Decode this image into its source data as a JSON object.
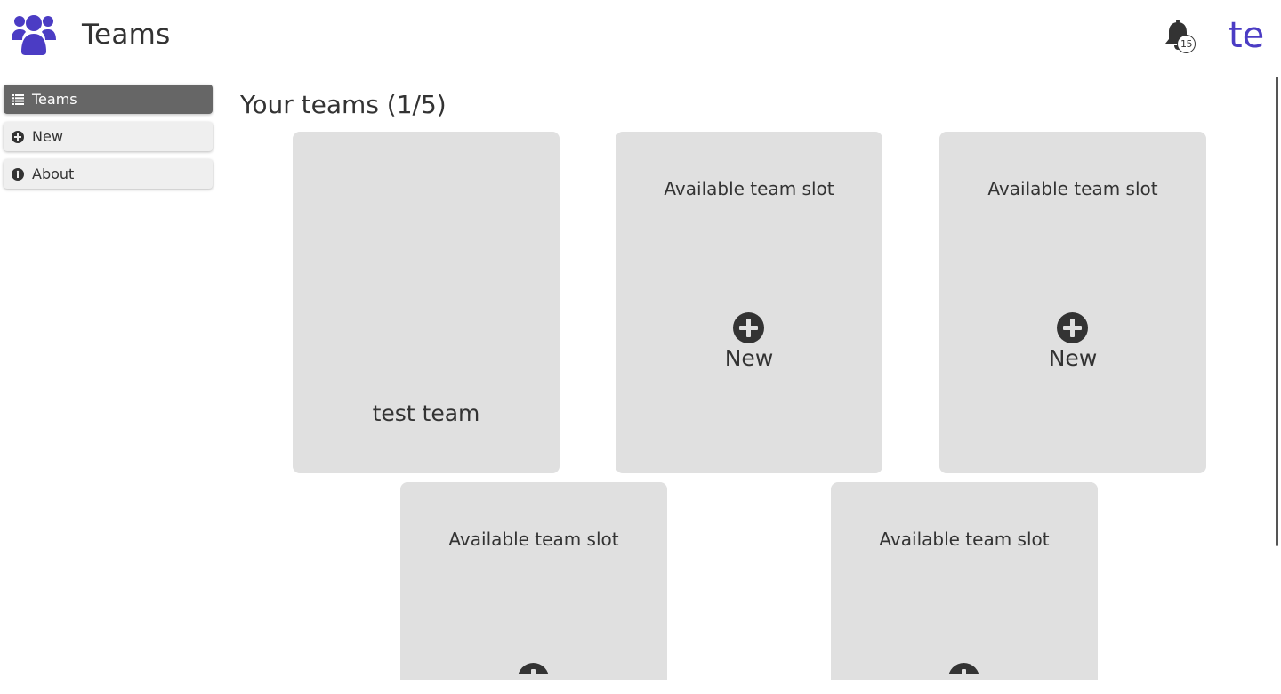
{
  "header": {
    "app_title": "Teams",
    "logo_icon": "users-icon",
    "notifications": {
      "icon": "bell-icon",
      "count": "15"
    },
    "user_initials": "te"
  },
  "sidebar": {
    "items": [
      {
        "label": "Teams",
        "icon": "list-icon",
        "active": true
      },
      {
        "label": "New",
        "icon": "plus-circle-icon",
        "active": false
      },
      {
        "label": "About",
        "icon": "info-circle-icon",
        "active": false
      }
    ]
  },
  "main": {
    "title": "Your teams (1/5)",
    "cards": [
      {
        "type": "team",
        "name": "test team"
      },
      {
        "type": "slot",
        "label": "Available team slot",
        "action": "New"
      },
      {
        "type": "slot",
        "label": "Available team slot",
        "action": "New"
      },
      {
        "type": "slot",
        "label": "Available team slot",
        "action": ""
      },
      {
        "type": "slot",
        "label": "Available team slot",
        "action": ""
      }
    ]
  },
  "colors": {
    "accent": "#4b3cc4",
    "card_bg": "#e0e0e0",
    "sidebar_active": "#666666",
    "text": "#333333"
  }
}
